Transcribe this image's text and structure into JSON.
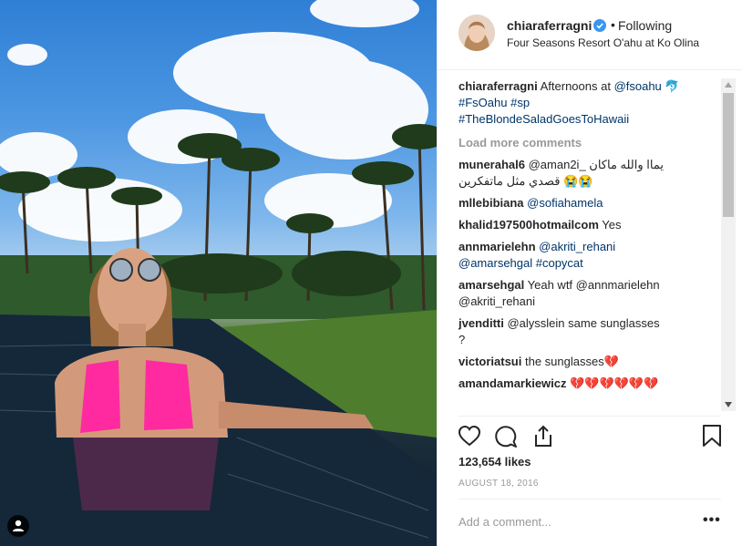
{
  "header": {
    "username": "chiaraferragni",
    "separator": "•",
    "follow_label": "Following",
    "location": "Four Seasons Resort O'ahu at Ko Olina"
  },
  "caption": {
    "username": "chiaraferragni",
    "text": "Afternoons at ",
    "mention": "@fsoahu",
    "emoji": "🐬",
    "hashtags_line1": "#FsOahu #sp",
    "hashtags_line2": "#TheBlondeSaladGoesToHawaii"
  },
  "load_more": "Load more comments",
  "comments": [
    {
      "username": "munerahal6",
      "text": "@aman2i_ يماا والله ماكان قصدي مثل ماتفكرين 😭😭"
    },
    {
      "username": "mllebibiana",
      "text": "@sofiahamela"
    },
    {
      "username": "khalid197500hotmailcom",
      "text": "Yes"
    },
    {
      "username": "annmarielehn",
      "text": "@akriti_rehani @amarsehgal #copycat"
    },
    {
      "username": "amarsehgal",
      "text": "Yeah wtf @annmarielehn @akriti_rehani"
    },
    {
      "username": "jvenditti",
      "text": "@alysslein same sunglasses ?"
    },
    {
      "username": "victoriatsui",
      "text": "the sunglasses💔"
    },
    {
      "username": "amandamarkiewicz",
      "text": "💔💔💔💔💔💔"
    }
  ],
  "actions": {
    "like_icon": "heart-icon",
    "comment_icon": "comment-icon",
    "share_icon": "share-icon",
    "save_icon": "bookmark-icon"
  },
  "likes": "123,654 likes",
  "date": "AUGUST 18, 2016",
  "add_comment": {
    "placeholder": "Add a comment..."
  },
  "more_options": "•••",
  "colors": {
    "verified": "#3897f0",
    "link": "#003569",
    "muted": "#999999"
  }
}
